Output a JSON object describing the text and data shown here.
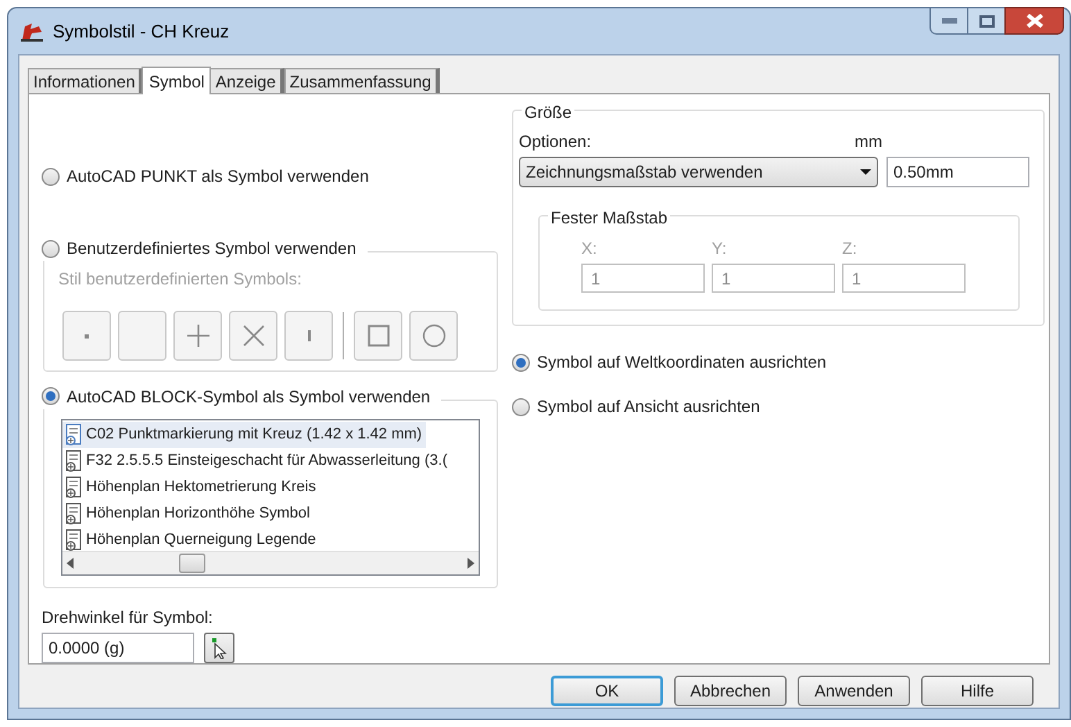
{
  "window": {
    "title": "Symbolstil - CH Kreuz"
  },
  "tabs": [
    {
      "label": "Informationen",
      "selected": false
    },
    {
      "label": "Symbol",
      "selected": true
    },
    {
      "label": "Anzeige",
      "selected": false
    },
    {
      "label": "Zusammenfassung",
      "selected": false
    }
  ],
  "symbol_source": [
    {
      "label": "AutoCAD PUNKT als Symbol verwenden",
      "selected": false
    },
    {
      "label": "Benutzerdefiniertes Symbol verwenden",
      "selected": false
    },
    {
      "label": "AutoCAD BLOCK-Symbol als Symbol verwenden",
      "selected": true
    }
  ],
  "custom_style": {
    "caption": "Stil benutzerdefinierten Symbols:",
    "disabled": true,
    "buttons": [
      {
        "kind": "dot"
      },
      {
        "kind": "blank"
      },
      {
        "kind": "plus"
      },
      {
        "kind": "cross"
      },
      {
        "kind": "tick"
      },
      {
        "kind": "square"
      },
      {
        "kind": "circle"
      }
    ]
  },
  "block_list": {
    "items": [
      {
        "label": "C02 Punktmarkierung mit Kreuz (1.42 x 1.42 mm)",
        "selected": true
      },
      {
        "label": "F32  2.5.5.5 Einsteigeschacht für Abwasserleitung (3.(",
        "selected": false
      },
      {
        "label": "Höhenplan Hektometrierung Kreis",
        "selected": false
      },
      {
        "label": "Höhenplan Horizonthöhe Symbol",
        "selected": false
      },
      {
        "label": "Höhenplan Querneigung Legende",
        "selected": false
      }
    ]
  },
  "rotation": {
    "label": "Drehwinkel für Symbol:",
    "value": "0.0000 (g)"
  },
  "size": {
    "title": "Größe",
    "options_label": "Optionen:",
    "option_value": "Zeichnungsmaßstab verwenden",
    "unit_label": "mm",
    "unit_value": "0.50mm",
    "fixed_scale": {
      "title": "Fester Maßstab",
      "disabled": true,
      "fields": [
        {
          "label": "X:",
          "value": "1"
        },
        {
          "label": "Y:",
          "value": "1"
        },
        {
          "label": "Z:",
          "value": "1"
        }
      ]
    }
  },
  "orientation": [
    {
      "label": "Symbol auf Weltkoordinaten ausrichten",
      "selected": true
    },
    {
      "label": "Symbol auf Ansicht ausrichten",
      "selected": false
    }
  ],
  "buttons": [
    {
      "label": "OK",
      "default": true
    },
    {
      "label": "Abbrechen",
      "default": false
    },
    {
      "label": "Anwenden",
      "default": false
    },
    {
      "label": "Hilfe",
      "default": false
    }
  ]
}
